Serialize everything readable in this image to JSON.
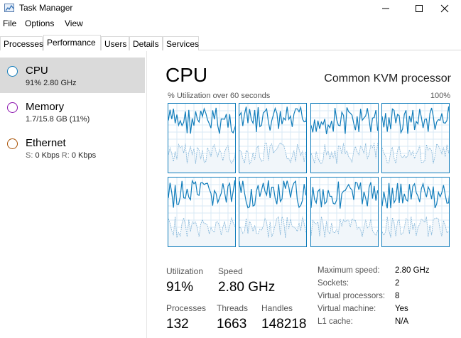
{
  "window": {
    "title": "Task Manager",
    "icon": "task-manager-icon"
  },
  "menu": [
    "File",
    "Options",
    "View"
  ],
  "tabs": [
    {
      "label": "Processes",
      "active": false
    },
    {
      "label": "Performance",
      "active": true
    },
    {
      "label": "Users",
      "active": false
    },
    {
      "label": "Details",
      "active": false
    },
    {
      "label": "Services",
      "active": false
    }
  ],
  "sidebar": {
    "items": [
      {
        "title": "CPU",
        "subtitle": "91%  2.80 GHz",
        "selected": true,
        "color": "#117dbb"
      },
      {
        "title": "Memory",
        "subtitle": "1.7/15.8 GB (11%)",
        "selected": false,
        "color": "#8b12ae"
      },
      {
        "title": "Ethernet",
        "subtitle_parts": {
          "s_label": "S:",
          "s_value": "0 Kbps",
          "r_label": "R:",
          "r_value": "0 Kbps"
        },
        "selected": false,
        "color": "#a74f01"
      }
    ]
  },
  "main": {
    "title": "CPU",
    "processor": "Common KVM processor",
    "graph_label": "% Utilization over 60 seconds",
    "graph_max": "100%",
    "graph_count": 8
  },
  "stats": {
    "utilization": {
      "label": "Utilization",
      "value": "91%"
    },
    "speed": {
      "label": "Speed",
      "value": "2.80 GHz"
    },
    "processes": {
      "label": "Processes",
      "value": "132"
    },
    "threads": {
      "label": "Threads",
      "value": "1663"
    },
    "handles": {
      "label": "Handles",
      "value": "148218"
    }
  },
  "details": [
    {
      "key": "Maximum speed:",
      "value": "2.80 GHz"
    },
    {
      "key": "Sockets:",
      "value": "2"
    },
    {
      "key": "Virtual processors:",
      "value": "8"
    },
    {
      "key": "Virtual machine:",
      "value": "Yes"
    },
    {
      "key": "L1 cache:",
      "value": "N/A"
    }
  ],
  "colors": {
    "cpu_line": "#117dbb",
    "cpu_fill": "#f1f6fa",
    "selected_bg": "#dadada"
  }
}
